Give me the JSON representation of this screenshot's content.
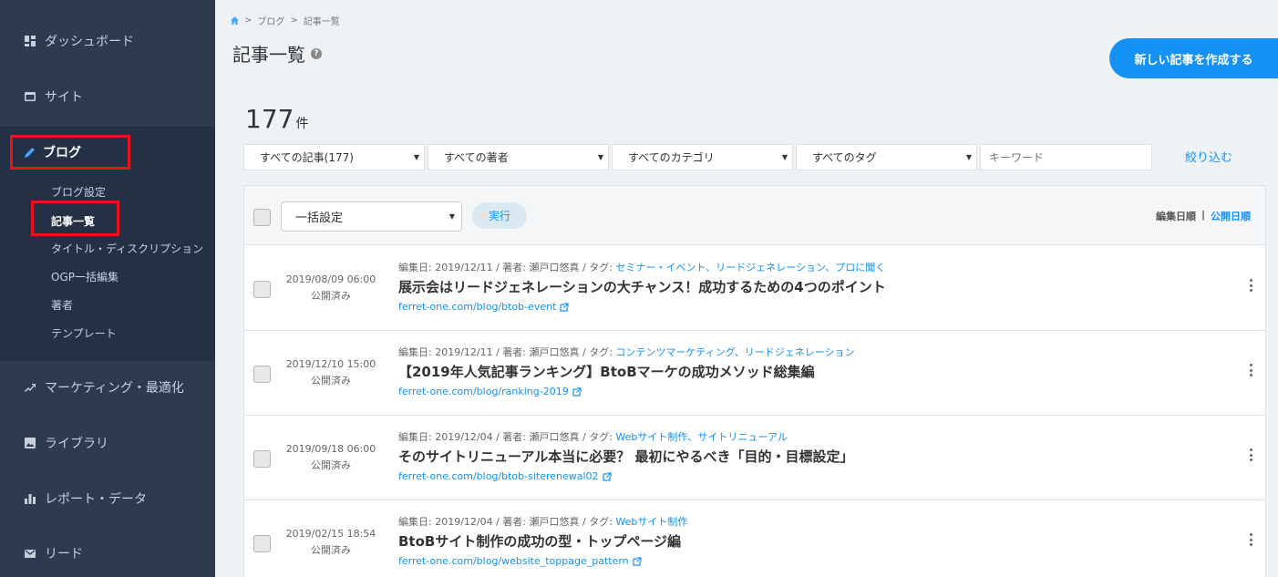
{
  "sidebar": {
    "items": [
      {
        "label": "ダッシュボード",
        "icon": "dashboard-icon"
      },
      {
        "label": "サイト",
        "icon": "site-icon"
      },
      {
        "label": "ブログ",
        "icon": "pencil-icon"
      },
      {
        "label": "マーケティング・最適化",
        "icon": "trend-icon"
      },
      {
        "label": "ライブラリ",
        "icon": "image-icon"
      },
      {
        "label": "レポート・データ",
        "icon": "bar-chart-icon"
      },
      {
        "label": "リード",
        "icon": "mail-icon"
      }
    ],
    "blog_sub": [
      {
        "label": "ブログ設定"
      },
      {
        "label": "記事一覧"
      },
      {
        "label": "タイトル・ディスクリプション"
      },
      {
        "label": "OGP一括編集"
      },
      {
        "label": "著者"
      },
      {
        "label": "テンプレート"
      }
    ]
  },
  "breadcrumb": {
    "sep": ">",
    "items": [
      "ブログ",
      "記事一覧"
    ]
  },
  "header": {
    "title": "記事一覧",
    "help": "?",
    "create_label": "新しい記事を作成する"
  },
  "count": {
    "value": "177",
    "unit": "件"
  },
  "filters": {
    "articles": "すべての記事(177)",
    "authors": "すべての著者",
    "categories": "すべてのカテゴリ",
    "tags": "すべてのタグ",
    "keyword_placeholder": "キーワード",
    "narrow_label": "絞り込む"
  },
  "bulk": {
    "select_label": "一括設定",
    "run_label": "実行",
    "sort_edit": "編集日順",
    "sort_sep": "|",
    "sort_publish": "公開日順"
  },
  "articles": [
    {
      "date": "2019/08/09 06:00",
      "status": "公開済み",
      "meta": "編集日: 2019/12/11 / 著者: 瀬戸口悠真 / タグ: ",
      "tags": "セミナー・イベント、リードジェネレーション、プロに聞く",
      "title": "展示会はリードジェネレーションの大チャンス！成功するための4つのポイント",
      "url": "ferret-one.com/blog/btob-event"
    },
    {
      "date": "2019/12/10 15:00",
      "status": "公開済み",
      "meta": "編集日: 2019/12/11 / 著者: 瀬戸口悠真 / タグ: ",
      "tags": "コンテンツマーケティング、リードジェネレーション",
      "title": "【2019年人気記事ランキング】BtoBマーケの成功メソッド総集編",
      "url": "ferret-one.com/blog/ranking-2019"
    },
    {
      "date": "2019/09/18 06:00",
      "status": "公開済み",
      "meta": "編集日: 2019/12/04 / 著者: 瀬戸口悠真 / タグ: ",
      "tags": "Webサイト制作、サイトリニューアル",
      "title": "そのサイトリニューアル本当に必要？ 最初にやるべき「目的・目標設定」",
      "url": "ferret-one.com/blog/btob-siterenewal02"
    },
    {
      "date": "2019/02/15 18:54",
      "status": "公開済み",
      "meta": "編集日: 2019/12/04 / 著者: 瀬戸口悠真 / タグ: ",
      "tags": "Webサイト制作",
      "title": "BtoBサイト制作の成功の型・トップページ編",
      "url": "ferret-one.com/blog/website_toppage_pattern"
    }
  ]
}
